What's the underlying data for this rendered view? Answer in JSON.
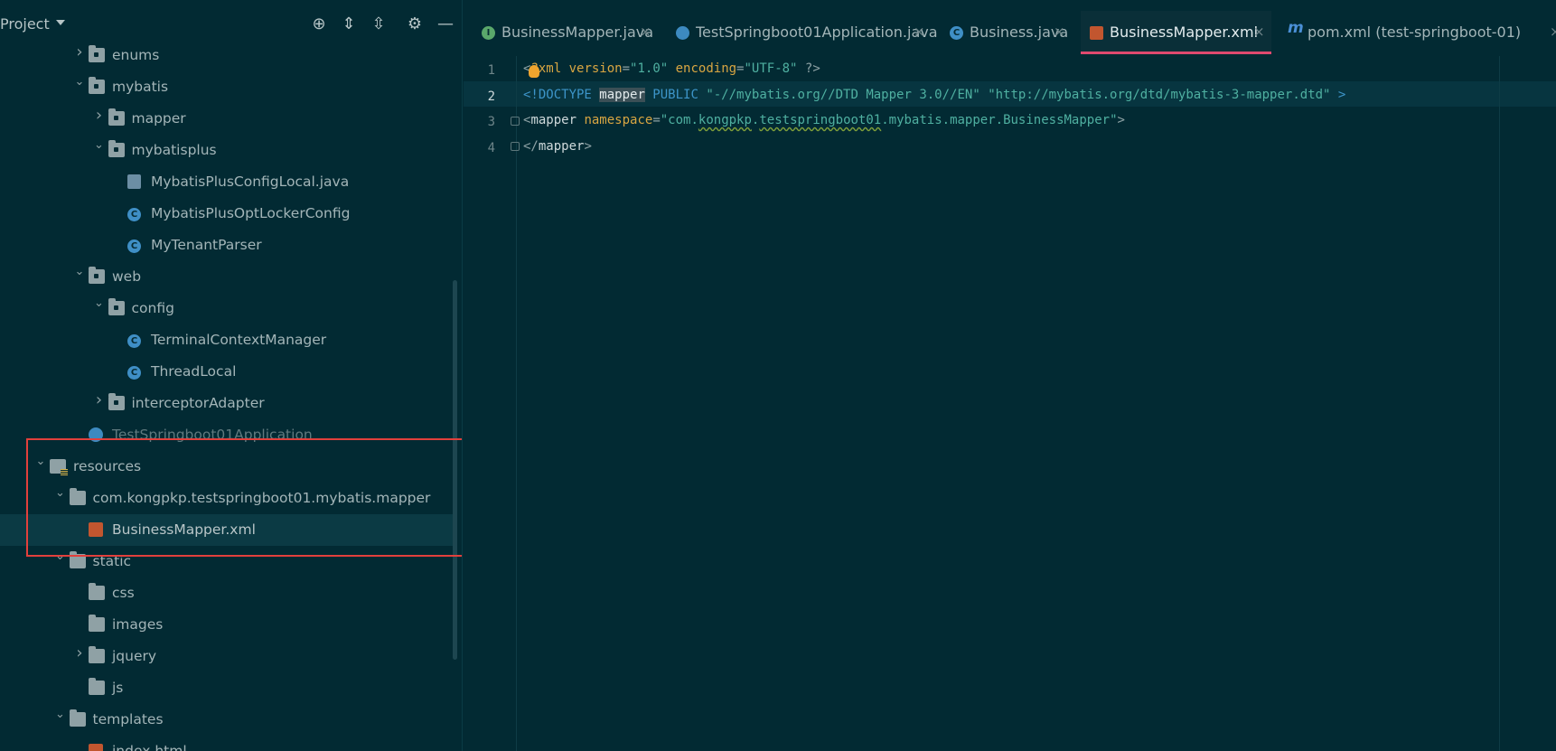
{
  "project_panel": {
    "title": "Project",
    "header_icons": [
      "locate-icon",
      "expand-all-icon",
      "collapse-all-icon",
      "settings-icon",
      "hide-icon"
    ],
    "tree": [
      {
        "label": "enums",
        "type": "package",
        "indent": 4,
        "chevron": "right"
      },
      {
        "label": "mybatis",
        "type": "package",
        "indent": 4,
        "chevron": "down"
      },
      {
        "label": "mapper",
        "type": "package",
        "indent": 5,
        "chevron": "right"
      },
      {
        "label": "mybatisplus",
        "type": "package",
        "indent": 5,
        "chevron": "down"
      },
      {
        "label": "MybatisPlusConfigLocal.java",
        "type": "java",
        "indent": 6,
        "chevron": ""
      },
      {
        "label": "MybatisPlusOptLockerConfig",
        "type": "class",
        "indent": 6,
        "chevron": ""
      },
      {
        "label": "MyTenantParser",
        "type": "class",
        "indent": 6,
        "chevron": ""
      },
      {
        "label": "web",
        "type": "package",
        "indent": 4,
        "chevron": "down"
      },
      {
        "label": "config",
        "type": "package",
        "indent": 5,
        "chevron": "down"
      },
      {
        "label": "TerminalContextManager",
        "type": "class",
        "indent": 6,
        "chevron": ""
      },
      {
        "label": "ThreadLocal",
        "type": "class",
        "indent": 6,
        "chevron": ""
      },
      {
        "label": "interceptorAdapter",
        "type": "package",
        "indent": 5,
        "chevron": "right"
      },
      {
        "label": "TestSpringboot01Application",
        "type": "app",
        "indent": 4,
        "chevron": "",
        "faded": true
      },
      {
        "label": "resources",
        "type": "resources",
        "indent": 2,
        "chevron": "down"
      },
      {
        "label": "com.kongpkp.testspringboot01.mybatis.mapper",
        "type": "folder",
        "indent": 3,
        "chevron": "down"
      },
      {
        "label": "BusinessMapper.xml",
        "type": "xml",
        "indent": 4,
        "chevron": "",
        "selected": true
      },
      {
        "label": "static",
        "type": "folder",
        "indent": 3,
        "chevron": "down"
      },
      {
        "label": "css",
        "type": "folder",
        "indent": 4,
        "chevron": ""
      },
      {
        "label": "images",
        "type": "folder",
        "indent": 4,
        "chevron": ""
      },
      {
        "label": "jquery",
        "type": "folder",
        "indent": 4,
        "chevron": "right"
      },
      {
        "label": "js",
        "type": "folder",
        "indent": 4,
        "chevron": ""
      },
      {
        "label": "templates",
        "type": "folder",
        "indent": 3,
        "chevron": "down"
      },
      {
        "label": "index.html",
        "type": "html",
        "indent": 4,
        "chevron": ""
      }
    ]
  },
  "editor": {
    "tabs": [
      {
        "label": "BusinessMapper.java",
        "icon": "interface-icon",
        "icon_letter": "I",
        "icon_color": "#5aa86b",
        "active": false
      },
      {
        "label": "TestSpringboot01Application.java",
        "icon": "spring-app-icon",
        "icon_letter": "",
        "icon_color": "#3d8ac0",
        "active": false
      },
      {
        "label": "Business.java",
        "icon": "class-icon",
        "icon_letter": "C",
        "icon_color": "#3f8fc6",
        "active": false
      },
      {
        "label": "BusinessMapper.xml",
        "icon": "xml-file-icon",
        "icon_letter": "",
        "icon_color": "#c2562f",
        "active": true
      },
      {
        "label": "pom.xml (test-springboot-01)",
        "icon": "maven-icon",
        "icon_letter": "m",
        "icon_color": "#4a8fd6",
        "active": false
      }
    ],
    "close_glyph": "×",
    "line_numbers": [
      "1",
      "2",
      "3",
      "4"
    ],
    "current_line": 2,
    "code": [
      [
        {
          "t": "<",
          "c": "punc"
        },
        {
          "t": "?xml",
          "c": "tag"
        },
        {
          "t": " version",
          "c": "attr"
        },
        {
          "t": "=",
          "c": "punc"
        },
        {
          "t": "\"1.0\"",
          "c": "str"
        },
        {
          "t": " encoding",
          "c": "attr"
        },
        {
          "t": "=",
          "c": "punc"
        },
        {
          "t": "\"UTF-8\"",
          "c": "str"
        },
        {
          "t": " ?>",
          "c": "punc"
        }
      ],
      [
        {
          "t": "<!DOCTYPE ",
          "c": "kw"
        },
        {
          "t": "mapper",
          "c": "hl"
        },
        {
          "t": " PUBLIC ",
          "c": "kw"
        },
        {
          "t": "\"-//mybatis.org//DTD Mapper 3.0//EN\"",
          "c": "str"
        },
        {
          "t": " ",
          "c": "plain"
        },
        {
          "t": "\"http://mybatis.org/dtd/mybatis-3-mapper.dtd\"",
          "c": "str"
        },
        {
          "t": " >",
          "c": "kw"
        }
      ],
      [
        {
          "t": "<",
          "c": "punc"
        },
        {
          "t": "mapper",
          "c": "plain"
        },
        {
          "t": " namespace",
          "c": "attr"
        },
        {
          "t": "=",
          "c": "punc"
        },
        {
          "t": "\"com.",
          "c": "str"
        },
        {
          "t": "kongpkp",
          "c": "str sq"
        },
        {
          "t": ".",
          "c": "str"
        },
        {
          "t": "testspringboot01",
          "c": "str sq"
        },
        {
          "t": ".mybatis.mapper.BusinessMapper\"",
          "c": "str"
        },
        {
          "t": ">",
          "c": "punc"
        }
      ],
      [
        {
          "t": "</",
          "c": "punc"
        },
        {
          "t": "mapper",
          "c": "plain"
        },
        {
          "t": ">",
          "c": "punc"
        }
      ]
    ]
  },
  "annotations": {
    "highlight_color": "#e2403c",
    "arrow_color": "#e2403c"
  }
}
